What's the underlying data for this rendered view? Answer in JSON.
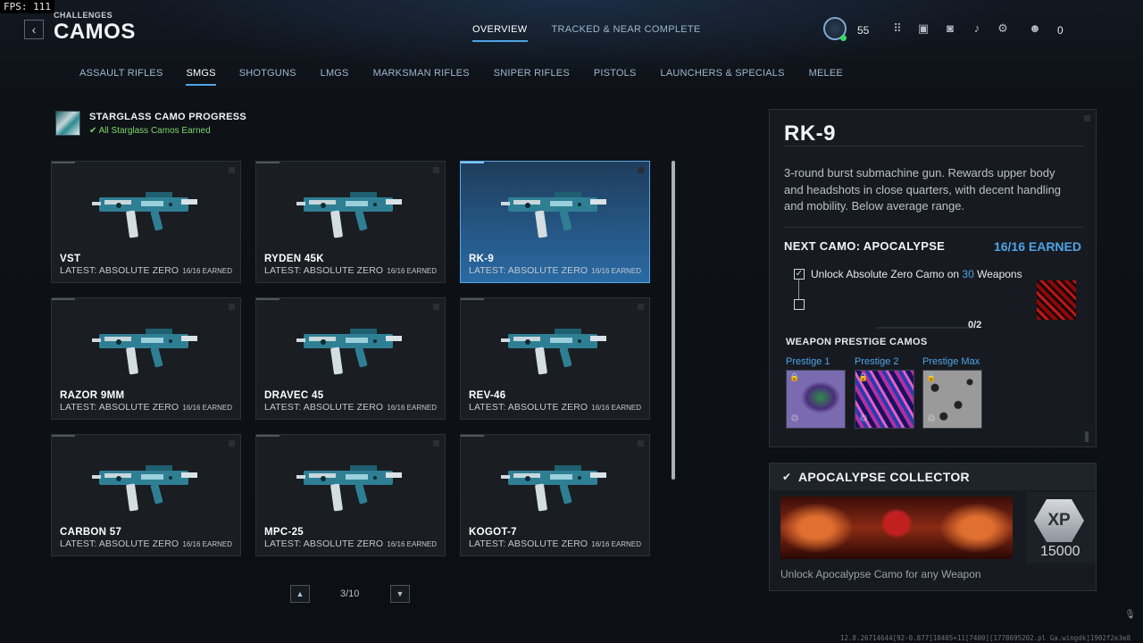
{
  "hud": {
    "fps": "FPS: 111",
    "rank_level": "55",
    "currency": "0"
  },
  "header": {
    "breadcrumb": "CHALLENGES",
    "title": "CAMOS",
    "tabs": [
      {
        "label": "OVERVIEW",
        "active": true
      },
      {
        "label": "TRACKED & NEAR COMPLETE",
        "active": false
      }
    ]
  },
  "categories": [
    {
      "label": "ASSAULT RIFLES",
      "active": false
    },
    {
      "label": "SMGS",
      "active": true
    },
    {
      "label": "SHOTGUNS",
      "active": false
    },
    {
      "label": "LMGS",
      "active": false
    },
    {
      "label": "MARKSMAN RIFLES",
      "active": false
    },
    {
      "label": "SNIPER RIFLES",
      "active": false
    },
    {
      "label": "PISTOLS",
      "active": false
    },
    {
      "label": "LAUNCHERS & SPECIALS",
      "active": false
    },
    {
      "label": "MELEE",
      "active": false
    }
  ],
  "starglass": {
    "title": "STARGLASS CAMO PROGRESS",
    "status": "All Starglass Camos Earned"
  },
  "weapons": [
    {
      "name": "VST",
      "latest": "LATEST: ABSOLUTE ZERO",
      "earned": "16/16 EARNED"
    },
    {
      "name": "RYDEN 45K",
      "latest": "LATEST: ABSOLUTE ZERO",
      "earned": "16/16 EARNED"
    },
    {
      "name": "RK-9",
      "latest": "LATEST: ABSOLUTE ZERO",
      "earned": "16/16 EARNED"
    },
    {
      "name": "RAZOR 9MM",
      "latest": "LATEST: ABSOLUTE ZERO",
      "earned": "16/16 EARNED"
    },
    {
      "name": "DRAVEC 45",
      "latest": "LATEST: ABSOLUTE ZERO",
      "earned": "16/16 EARNED"
    },
    {
      "name": "REV-46",
      "latest": "LATEST: ABSOLUTE ZERO",
      "earned": "16/16 EARNED"
    },
    {
      "name": "CARBON 57",
      "latest": "LATEST: ABSOLUTE ZERO",
      "earned": "16/16 EARNED"
    },
    {
      "name": "MPC-25",
      "latest": "LATEST: ABSOLUTE ZERO",
      "earned": "16/16 EARNED"
    },
    {
      "name": "KOGOT-7",
      "latest": "LATEST: ABSOLUTE ZERO",
      "earned": "16/16 EARNED"
    }
  ],
  "selected_index": 2,
  "pagination": {
    "label": "3/10"
  },
  "detail": {
    "title": "RK-9",
    "description": "3-round burst submachine gun. Rewards upper body and headshots in close quarters, with decent handling and mobility. Below average range.",
    "next_camo": "NEXT CAMO: APOCALYPSE",
    "earned": "16/16 EARNED",
    "requirement_prefix": "Unlock Absolute Zero Camo on ",
    "requirement_count": "30",
    "requirement_suffix": " Weapons",
    "progress": "0/2",
    "prestige_title": "WEAPON PRESTIGE CAMOS",
    "prestige": [
      {
        "label": "Prestige 1"
      },
      {
        "label": "Prestige 2"
      },
      {
        "label": "Prestige Max"
      }
    ]
  },
  "collector": {
    "title": "APOCALYPSE COLLECTOR",
    "xp_label": "XP",
    "xp_value": "15000",
    "description": "Unlock Apocalypse Camo for any Weapon"
  },
  "build_info": "12.8.26714644[92-0.877]10405+11[7400][1778695202.pl Ga.wingdk]1902f2e3e8"
}
